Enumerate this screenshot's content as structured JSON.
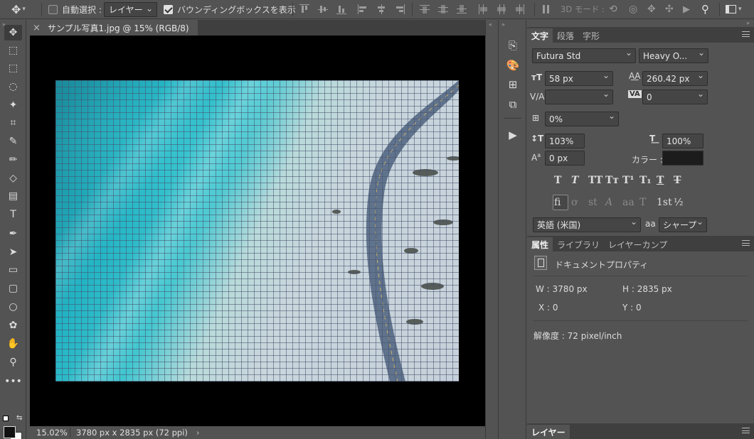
{
  "options_bar": {
    "move_icon": "move-tool-icon",
    "auto_select_label": "自動選択 :",
    "auto_select_checked": false,
    "auto_select_target": "レイヤー",
    "bounding_box_label": "バウンディングボックスを表示",
    "bounding_box_checked": true,
    "mode_3d_label": "3D モード :"
  },
  "document": {
    "tab_title": "サンプル写真1.jpg @ 15% (RGB/8)",
    "close_glyph": "×",
    "zoom": "15.02%",
    "doc_info": "3780 px x 2835 px (72 ppi)",
    "more_glyph": "›"
  },
  "tools": [
    {
      "name": "move-tool",
      "glyph": "✥",
      "active": true
    },
    {
      "name": "artboard-tool",
      "glyph": "⬚"
    },
    {
      "name": "marquee-tool",
      "glyph": "⬚"
    },
    {
      "name": "lasso-tool",
      "glyph": "◌"
    },
    {
      "name": "magic-wand-tool",
      "glyph": "✦"
    },
    {
      "name": "crop-tool",
      "glyph": "⌗"
    },
    {
      "name": "eyedropper-tool",
      "glyph": "✎"
    },
    {
      "name": "brush-tool",
      "glyph": "✏"
    },
    {
      "name": "eraser-tool",
      "glyph": "◇"
    },
    {
      "name": "gradient-tool",
      "glyph": "▤"
    },
    {
      "name": "type-tool",
      "glyph": "T"
    },
    {
      "name": "pen-tool",
      "glyph": "✒"
    },
    {
      "name": "path-select-tool",
      "glyph": "➤"
    },
    {
      "name": "rectangle-tool",
      "glyph": "▭"
    },
    {
      "name": "rounded-rect-tool",
      "glyph": "▢"
    },
    {
      "name": "ellipse-tool",
      "glyph": "○"
    },
    {
      "name": "custom-shape-tool",
      "glyph": "✿"
    },
    {
      "name": "hand-tool",
      "glyph": "✋"
    },
    {
      "name": "zoom-tool",
      "glyph": "⚲"
    },
    {
      "name": "more-tools",
      "glyph": "•••"
    }
  ],
  "character_panel": {
    "tabs": [
      "文字",
      "段落",
      "字形"
    ],
    "active_tab": 0,
    "font_family": "Futura Std",
    "font_style": "Heavy O...",
    "font_size": "58 px",
    "leading": "260.42 px",
    "kerning": "",
    "tracking": "0",
    "tsume": "0%",
    "vertical_scale": "103%",
    "horizontal_scale": "100%",
    "baseline_shift": "0 px",
    "color_label": "カラー :",
    "color_value": "#1c1c1c",
    "typo_buttons": [
      "T",
      "T",
      "TT",
      "Tт",
      "T¹",
      "T₁",
      "T",
      "T"
    ],
    "opentype_buttons": [
      "fi",
      "ơ",
      "st",
      "A",
      "aa",
      "T",
      "1st",
      "½"
    ],
    "language": "英語 (米国)",
    "aa_label": "aa",
    "antialias": "シャープ"
  },
  "properties_panel": {
    "tabs": [
      "属性",
      "ライブラリ",
      "レイヤーカンプ"
    ],
    "active_tab": 0,
    "section_title": "ドキュメントプロパティ",
    "w_label": "W : 3780 px",
    "h_label": "H : 2835 px",
    "x_label": "X : 0",
    "y_label": "Y : 0",
    "resolution": "解像度 : 72 pixel/inch"
  },
  "layers_panel": {
    "tab": "レイヤー"
  },
  "colors": {
    "ui_bg": "#535353",
    "ui_dark": "#3f3f3f",
    "field_bg": "#454545",
    "canvas_bg": "#000000",
    "foreground": "#111111",
    "background": "#ffffff"
  }
}
